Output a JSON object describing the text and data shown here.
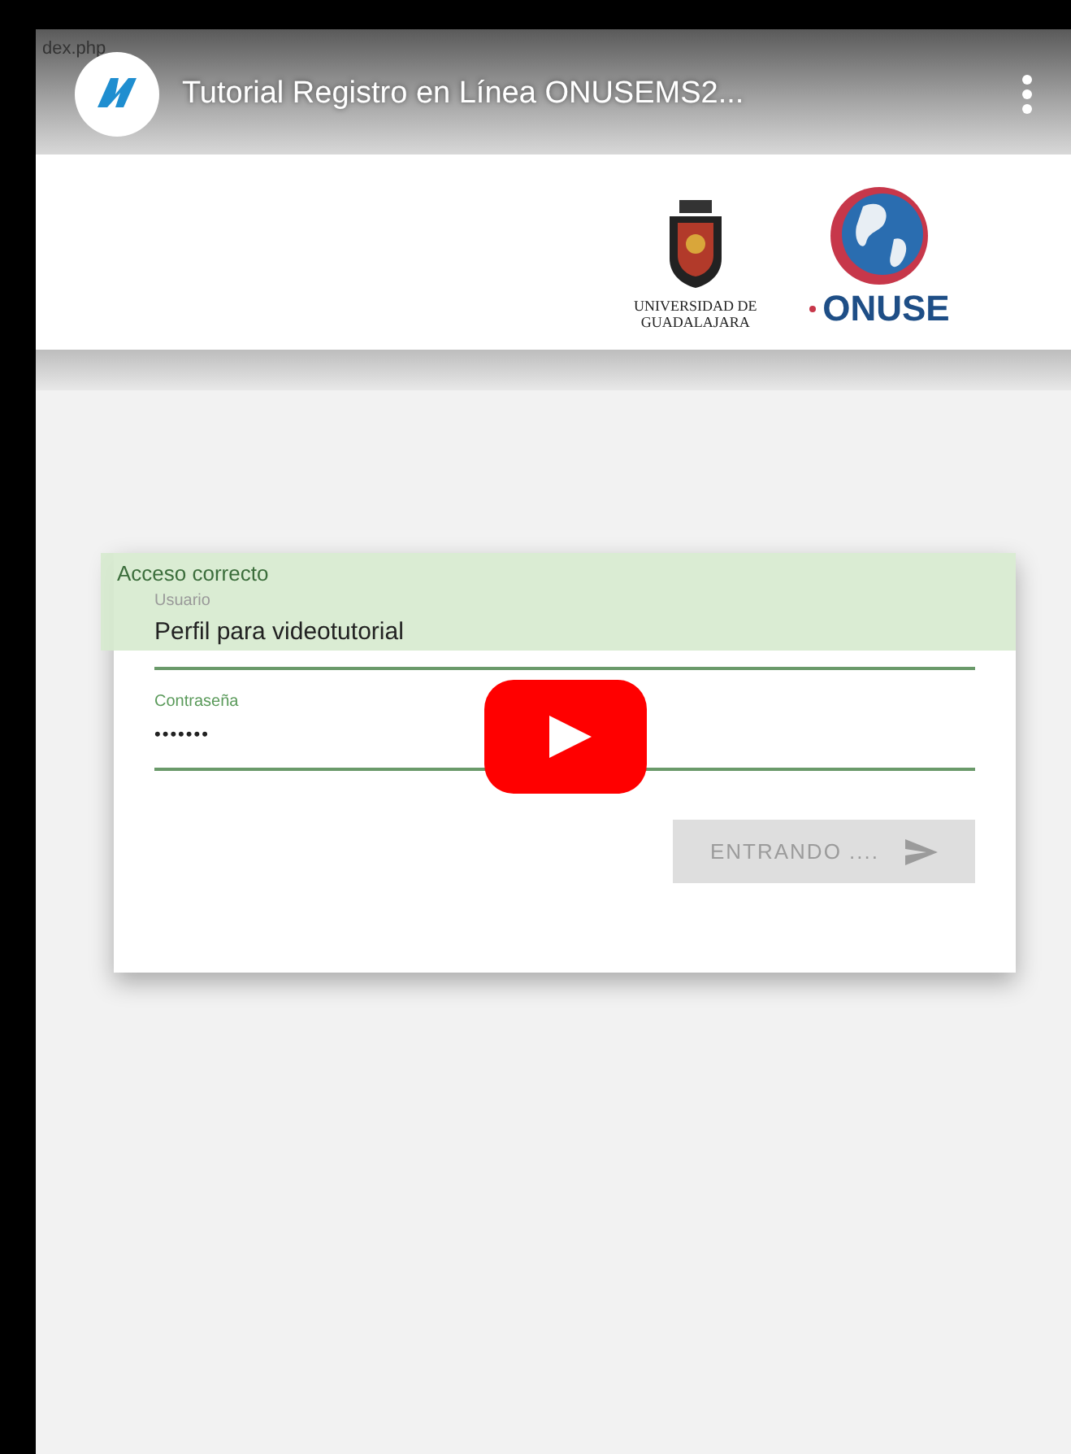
{
  "video": {
    "url_fragment": "dex.php",
    "title": "Tutorial Registro en Línea ONUSEMS2..."
  },
  "site_header": {
    "university_lines": [
      "UNIVERSIDAD DE",
      "GUADALAJARA"
    ],
    "brand": "ONUSE"
  },
  "login": {
    "alert": "Acceso correcto",
    "fields": [
      {
        "kind": "text",
        "label": "Usuario",
        "value": "Perfil para videotutorial"
      },
      {
        "kind": "password",
        "label": "Contraseña",
        "value": "•••••••"
      }
    ],
    "button": {
      "label": "ENTRANDO ....",
      "disabled": true
    }
  }
}
